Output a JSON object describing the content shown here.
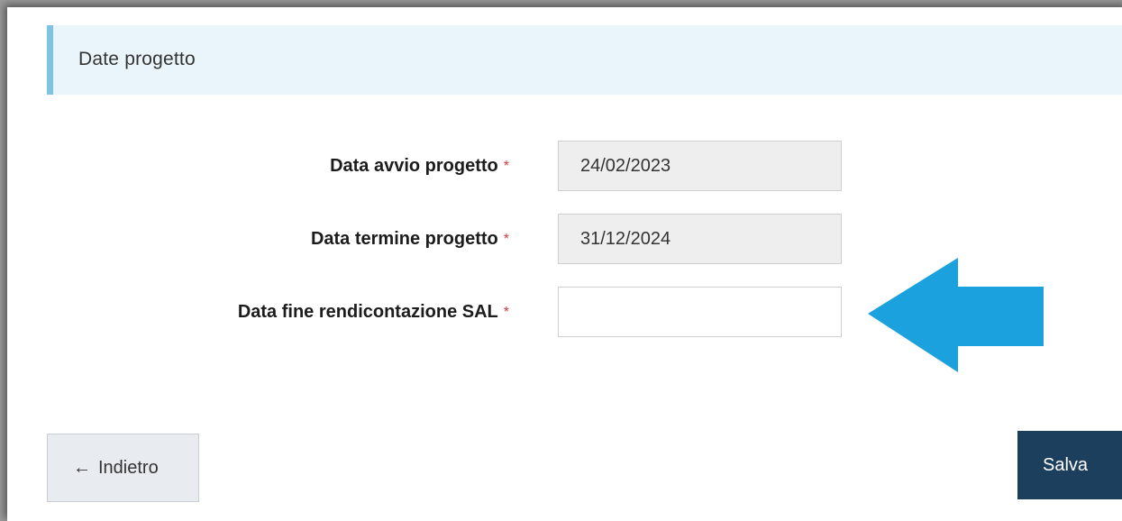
{
  "section": {
    "title": "Date progetto"
  },
  "fields": [
    {
      "label": "Data avvio progetto",
      "required_mark": "*",
      "value": "24/02/2023"
    },
    {
      "label": "Data termine progetto",
      "required_mark": "*",
      "value": "31/12/2024"
    },
    {
      "label": "Data fine rendicontazione SAL",
      "required_mark": "*",
      "value": ""
    }
  ],
  "buttons": {
    "back_icon": "←",
    "back_label": "Indietro",
    "save_label": "Salva"
  },
  "colors": {
    "header_bg": "#eaf5fb",
    "header_accent": "#7ec3e6",
    "required": "#cf3a3a",
    "readonly_bg": "#eeeeee",
    "arrow": "#1ba1de",
    "save_bg": "#1d3f5e",
    "back_bg": "#e8ecf1"
  },
  "annotation": {
    "icon": "left-arrow-icon"
  }
}
